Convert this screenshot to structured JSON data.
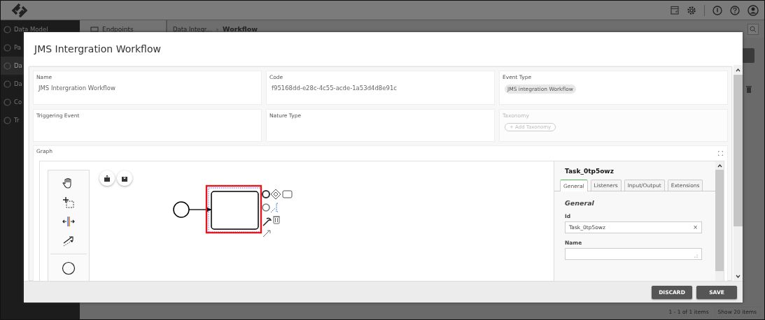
{
  "app": {
    "sidebar": [
      {
        "label": "Data Model",
        "selected": false
      },
      {
        "label": "Pa",
        "selected": false
      },
      {
        "label": "Da",
        "selected": true
      },
      {
        "label": "Da",
        "selected": false
      },
      {
        "label": "Co",
        "selected": false
      },
      {
        "label": "Tr",
        "selected": false
      }
    ],
    "tab_label": "Endpoints",
    "breadcrumb": [
      "Data Integr...",
      "Workflow"
    ],
    "breadcrumb_separator": "›",
    "pagination": {
      "summary": "1 - 1 of 1 items",
      "page_size": "Show 20 items"
    }
  },
  "modal": {
    "title": "JMS Intergration Workflow",
    "fields": [
      {
        "label": "Name",
        "kind": "text",
        "value": "JMS Intergration Workflow",
        "disabled": false
      },
      {
        "label": "Code",
        "kind": "text",
        "value": "f95168dd-e28c-4c55-acde-1a53d4d8e91c",
        "disabled": false
      },
      {
        "label": "Event Type",
        "kind": "chips",
        "chips": [
          "JMS integration Workflow"
        ],
        "disabled": false
      },
      {
        "label": "Triggering Event",
        "kind": "text",
        "disabled": false
      },
      {
        "label": "Nature Type",
        "kind": "text",
        "disabled": false
      },
      {
        "label": "Taxonomy",
        "kind": "add",
        "action": "+ Add Taxonomy",
        "disabled": true
      }
    ],
    "graph": {
      "label": "Graph",
      "properties": {
        "title": "Task_0tp5owz",
        "tabs": [
          {
            "label": "General",
            "selected": true
          },
          {
            "label": "Listeners",
            "selected": false
          },
          {
            "label": "Input/Output",
            "selected": false
          },
          {
            "label": "Extensions",
            "selected": false
          }
        ],
        "section": "General",
        "fields": [
          {
            "label": "Id",
            "kind": "input",
            "value": "Task_0tp5owz",
            "clear": "×"
          },
          {
            "label": "Name",
            "kind": "textarea"
          }
        ]
      }
    },
    "buttons": [
      {
        "label": "DISCARD"
      },
      {
        "label": "SAVE"
      }
    ]
  }
}
